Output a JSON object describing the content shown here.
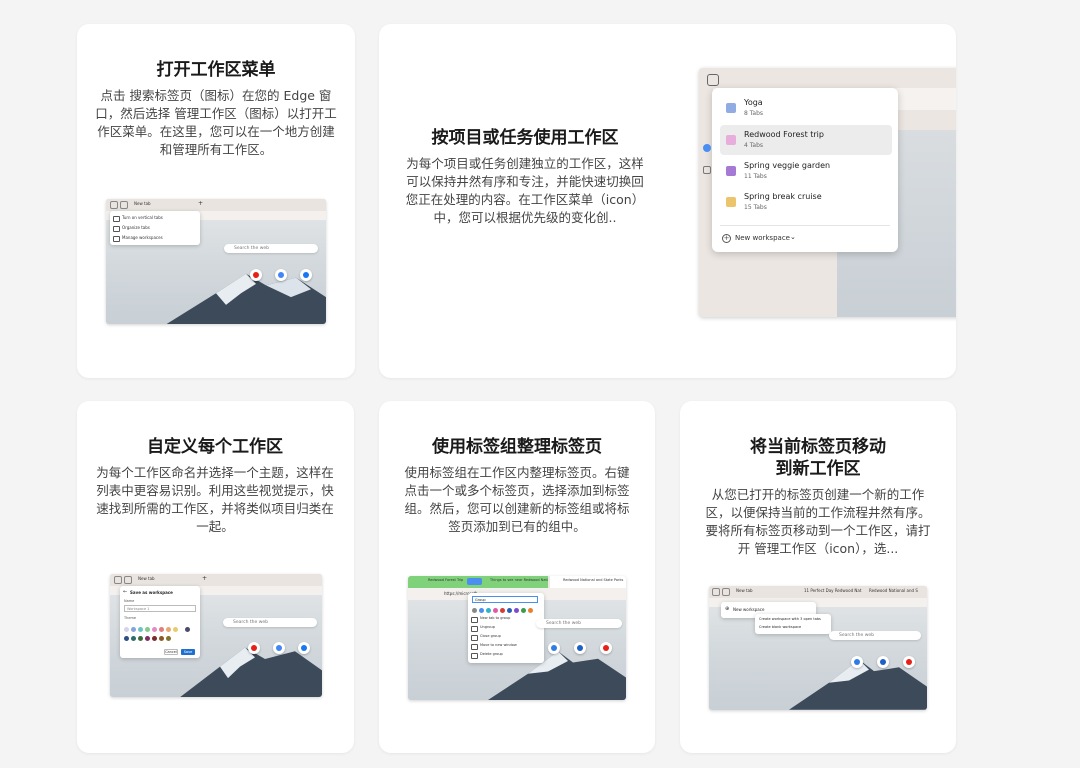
{
  "cards": {
    "open_menu": {
      "title": "打开工作区菜单",
      "description": "点击 搜索标签页（图标）在您的 Edge 窗口，然后选择 管理工作区（图标）以打开工作区菜单。在这里，您可以在一个地方创建和管理所有工作区。",
      "shot": {
        "tab_label": "New tab",
        "menu_items": [
          "Turn on vertical tabs",
          "Organize tabs",
          "Manage workspaces"
        ],
        "search_placeholder": "Search the web"
      }
    },
    "per_project": {
      "title": "按项目或任务使用工作区",
      "description": "为每个项目或任务创建独立的工作区，这样可以保持井然有序和专注，并能快速切换回您正在处理的内容。在工作区菜单（icon）中，您可以根据优先级的变化创..",
      "workspaces": [
        {
          "name": "Yoga",
          "count": "8 Tabs",
          "color": "#6c8fd9",
          "selected": false
        },
        {
          "name": "Redwood Forest trip",
          "count": "4 Tabs",
          "color": "#e59ad6",
          "selected": true
        },
        {
          "name": "Spring veggie garden",
          "count": "11 Tabs",
          "color": "#8f59c9",
          "selected": false
        },
        {
          "name": "Spring break cruise",
          "count": "15 Tabs",
          "color": "#e7b54a",
          "selected": false
        }
      ],
      "new_workspace_label": "New workspace"
    },
    "customize": {
      "title": "自定义每个工作区",
      "description": "为每个工作区命名并选择一个主题，这样在列表中更容易识别。利用这些视觉提示，快速找到所需的工作区，并将类似项目归类在一起。",
      "shot": {
        "tab_label": "New tab",
        "dialog_title": "Save as workspace",
        "name_label": "Name",
        "name_placeholder": "Workspace 1",
        "theme_label": "Theme",
        "cancel_label": "Cancel",
        "save_label": "Save",
        "search_placeholder": "Search the web"
      }
    },
    "tab_groups": {
      "title": "使用标签组整理标签页",
      "description": "使用标签组在工作区内整理标签页。右键点击一个或多个标签页，选择添加到标签组。然后，您可以创建新的标签组或将标签页添加到已有的组中。",
      "shot": {
        "address": "https://microsoft",
        "group_name": "Group",
        "menu_items": [
          "New tab to group",
          "Ungroup",
          "Close group",
          "Move to new window",
          "Delete group"
        ],
        "search_placeholder": "Search the web",
        "tab_labels": [
          "Redwood Forest Trip",
          "Things to see near Redwood Nati",
          "Redwood National and State Parks"
        ]
      }
    },
    "move_tabs": {
      "title_line1": "将当前标签页移动",
      "title_line2": "到新工作区",
      "description": "从您已打开的标签页创建一个新的工作区，以便保持当前的工作流程井然有序。要将所有标签页移动到一个工作区，请打开 管理工作区（icon），选...",
      "shot": {
        "tab_labels": [
          "New tab",
          "11 Perfect Day Redwood Nat",
          "Redwood National and S"
        ],
        "new_workspace_label": "New workspace",
        "menu_items": [
          "Create workspace with 3 open tabs",
          "Create blank workspace"
        ],
        "search_placeholder": "Search the web"
      }
    }
  },
  "colors": {
    "page_bg": "#f4f4f4",
    "card_bg": "#ffffff",
    "tab_group_green": "#7fd17a",
    "tab_group_blue": "#4a8ef2"
  }
}
